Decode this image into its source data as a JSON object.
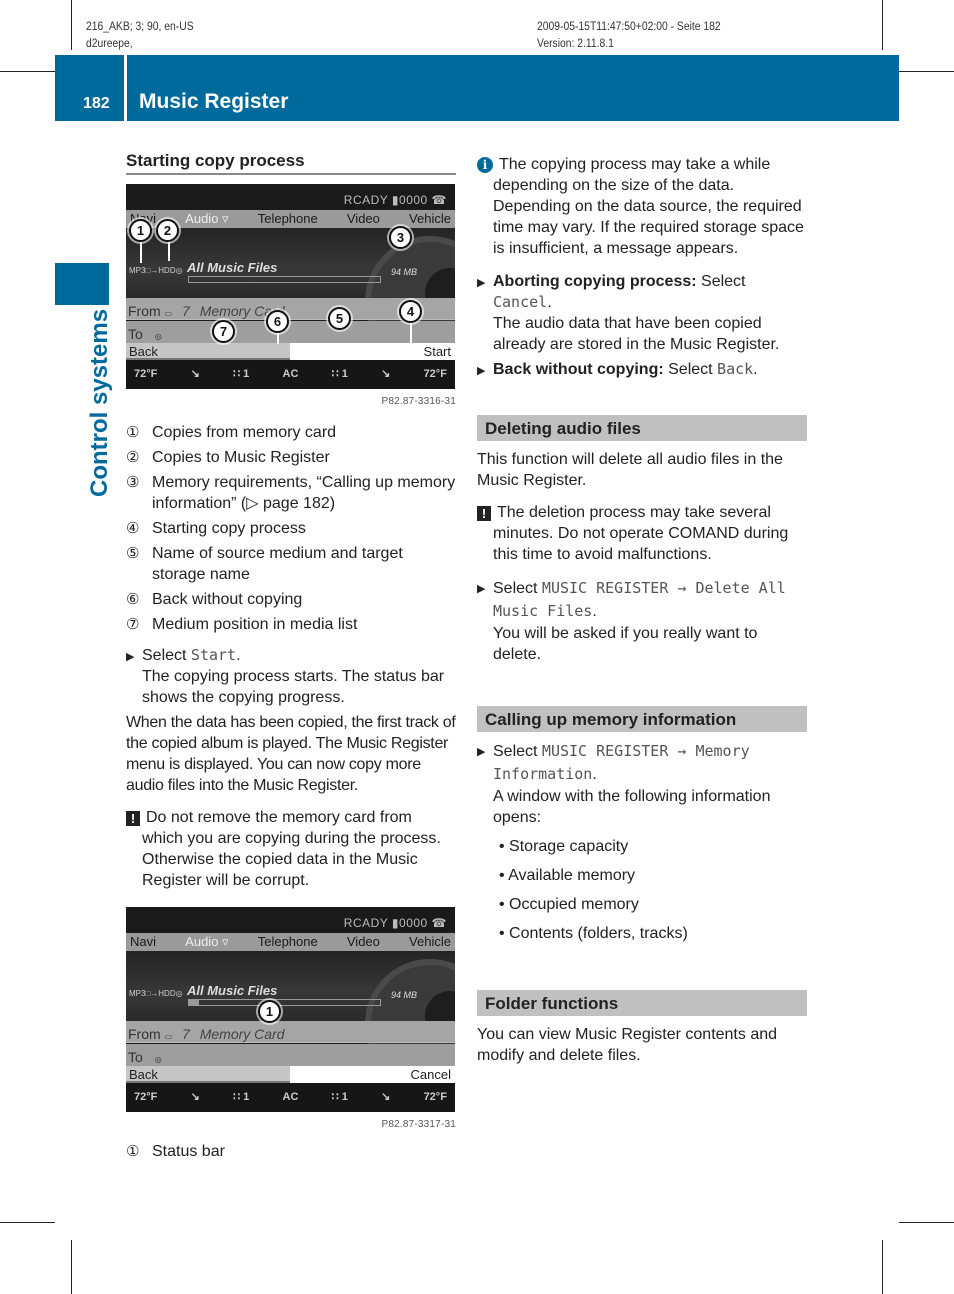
{
  "meta": {
    "doc_id": "216_AKB; 3; 90, en-US",
    "author": "d2ureepe,",
    "timestamp": "2009-05-15T11:47:50+02:00 - Seite 182",
    "version": "Version: 2.11.8.1"
  },
  "header": {
    "page_number": "182",
    "chapter_title": "Music Register",
    "accent_color": "#006a9c"
  },
  "side_tab": {
    "label": "Control systems"
  },
  "left": {
    "heading": "Starting copy process",
    "screen1": {
      "status": "RCADY ▮0000 ☎",
      "menu": [
        "Navi",
        "Audio ▿",
        "Telephone",
        "Video",
        "Vehicle"
      ],
      "files_label": "All Music Files",
      "size": "94 MB",
      "icons": "MP3□→HDD◎",
      "from_label": "From",
      "from_pos": "7",
      "from_medium": "Memory Card",
      "to_label": "To",
      "back": "Back",
      "action": "Start",
      "progress": 0,
      "climate": [
        "72°F",
        "↘",
        "∷ 1",
        "AC",
        "∷ 1",
        "↘",
        "72°F"
      ],
      "callouts": [
        "1",
        "2",
        "3",
        "4",
        "5",
        "6",
        "7"
      ],
      "fig_code": "P82.87-3316-31"
    },
    "legend": [
      {
        "num": "①",
        "text": "Copies from memory card"
      },
      {
        "num": "②",
        "text": "Copies to Music Register"
      },
      {
        "num": "③",
        "text": "Memory requirements, “Calling up memory information” (▷ page 182)"
      },
      {
        "num": "④",
        "text": "Starting copy process"
      },
      {
        "num": "⑤",
        "text": "Name of source medium and target storage name"
      },
      {
        "num": "⑥",
        "text": "Back without copying"
      },
      {
        "num": "⑦",
        "text": "Medium position in media list"
      }
    ],
    "step_select": "Select",
    "step_code": "Start",
    "step_result": "The copying process starts. The status bar shows the copying progress.",
    "paragraph": "When the data has been copied, the first track of the copied album is played. The Music Register menu is displayed. You can now copy more audio files into the Music Register.",
    "warning": "Do not remove the memory card from which you are copying during the process. Otherwise the copied data in the Music Register will be corrupt.",
    "screen2": {
      "status": "RCADY ▮0000 ☎",
      "menu": [
        "Navi",
        "Audio ▿",
        "Telephone",
        "Video",
        "Vehicle"
      ],
      "files_label": "All Music Files",
      "size": "94 MB",
      "icons": "MP3□→HDD◎",
      "from_label": "From",
      "from_pos": "7",
      "from_medium": "Memory Card",
      "to_label": "To",
      "back": "Back",
      "action": "Cancel",
      "progress": 0.05,
      "climate": [
        "72°F",
        "↘",
        "∷ 1",
        "AC",
        "∷ 1",
        "↘",
        "72°F"
      ],
      "callouts": [
        "1"
      ],
      "fig_code": "P82.87-3317-31"
    },
    "legend2": [
      {
        "num": "①",
        "text": "Status bar"
      }
    ]
  },
  "right": {
    "info": "The copying process may take a while depending on the size of the data. Depending on the data source, the required time may vary. If the required storage space is insufficient, a message appears.",
    "abort_label": "Aborting copying process:",
    "abort_select": "Select",
    "abort_code": "Cancel",
    "abort_result": "The audio data that have been copied already are stored in the Music Register.",
    "back_label": "Back without copying:",
    "back_select": "Select",
    "back_code": "Back",
    "sections": {
      "deleting": {
        "heading": "Deleting audio files",
        "intro": "This function will delete all audio files in the Music Register.",
        "warning": "The deletion process may take several minutes. Do not operate COMAND during this time to avoid malfunctions.",
        "select": "Select",
        "code": "MUSIC REGISTER → Delete All Music Files",
        "result": "You will be asked if you really want to delete."
      },
      "memory": {
        "heading": "Calling up memory information",
        "select": "Select",
        "code": "MUSIC REGISTER → Memory Information",
        "result": "A window with the following information opens:",
        "bullets": [
          "Storage capacity",
          "Available memory",
          "Occupied memory",
          "Contents (folders, tracks)"
        ]
      },
      "folder": {
        "heading": "Folder functions",
        "text": "You can view Music Register contents and modify and delete files."
      }
    }
  }
}
